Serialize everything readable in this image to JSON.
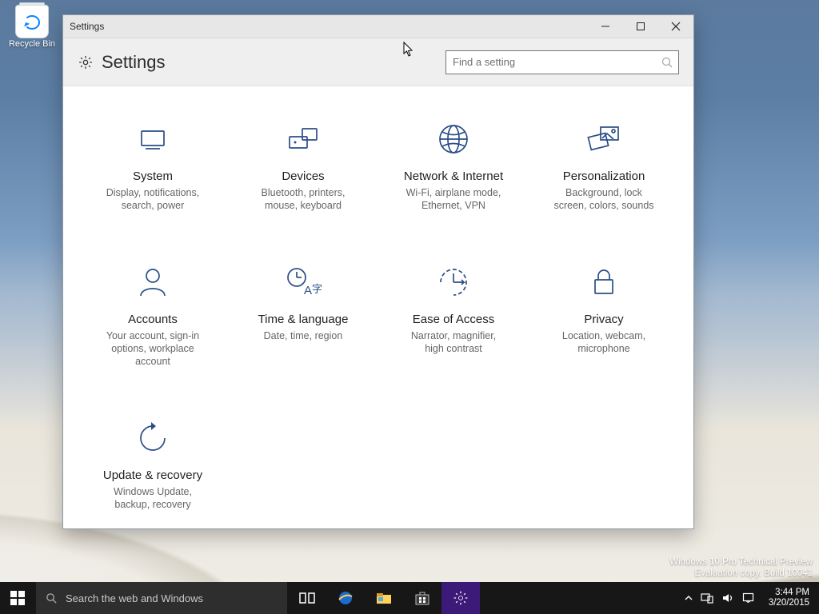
{
  "desktop": {
    "recycle_bin_label": "Recycle Bin",
    "watermark_line1": "Windows 10 Pro Technical Preview",
    "watermark_line2": "Evaluation copy. Build 10041"
  },
  "window": {
    "title": "Settings",
    "header": "Settings",
    "search_placeholder": "Find a setting"
  },
  "tiles": [
    {
      "id": "system",
      "title": "System",
      "desc": "Display, notifications,\nsearch, power"
    },
    {
      "id": "devices",
      "title": "Devices",
      "desc": "Bluetooth, printers,\nmouse, keyboard"
    },
    {
      "id": "network",
      "title": "Network & Internet",
      "desc": "Wi-Fi, airplane mode,\nEthernet, VPN"
    },
    {
      "id": "personal",
      "title": "Personalization",
      "desc": "Background, lock\nscreen, colors, sounds"
    },
    {
      "id": "accounts",
      "title": "Accounts",
      "desc": "Your account, sign-in\noptions, workplace\naccount"
    },
    {
      "id": "time",
      "title": "Time & language",
      "desc": "Date, time, region"
    },
    {
      "id": "ease",
      "title": "Ease of Access",
      "desc": "Narrator, magnifier,\nhigh contrast"
    },
    {
      "id": "privacy",
      "title": "Privacy",
      "desc": "Location, webcam,\nmicrophone"
    },
    {
      "id": "update",
      "title": "Update & recovery",
      "desc": "Windows Update,\nbackup, recovery"
    }
  ],
  "taskbar": {
    "search_placeholder": "Search the web and Windows",
    "time": "3:44 PM",
    "date": "3/20/2015",
    "apps": [
      "task-view-icon",
      "internet-explorer-icon",
      "file-explorer-icon",
      "store-icon"
    ]
  }
}
